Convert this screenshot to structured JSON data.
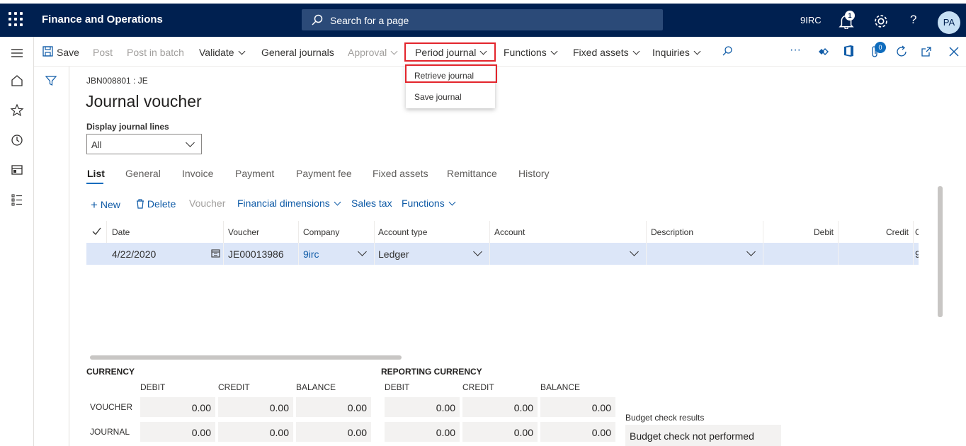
{
  "app": {
    "title": "Finance and Operations",
    "search_placeholder": "Search for a page",
    "company": "9IRC",
    "notification_count": "1",
    "user_initials": "PA",
    "help_glyph": "?"
  },
  "action_pane": {
    "save": "Save",
    "post": "Post",
    "post_in_batch": "Post in batch",
    "validate": "Validate",
    "general_journals": "General journals",
    "approval": "Approval",
    "period_journal": "Period journal",
    "functions": "Functions",
    "fixed_assets": "Fixed assets",
    "inquiries": "Inquiries",
    "more": "···",
    "attachments_count": "0"
  },
  "period_menu": {
    "items": [
      "Retrieve journal",
      "Save journal"
    ]
  },
  "header": {
    "caption": "JBN008801 : JE",
    "title": "Journal voucher",
    "display_lines_label": "Display journal lines",
    "display_lines_value": "All"
  },
  "tabs": [
    "List",
    "General",
    "Invoice",
    "Payment",
    "Payment fee",
    "Fixed assets",
    "Remittance",
    "History"
  ],
  "grid_toolbar": {
    "new": "New",
    "delete": "Delete",
    "voucher": "Voucher",
    "financial_dimensions": "Financial dimensions",
    "sales_tax": "Sales tax",
    "functions": "Functions"
  },
  "grid": {
    "columns": [
      "Date",
      "Voucher",
      "Company",
      "Account type",
      "Account",
      "Description",
      "Debit",
      "Credit",
      "C"
    ],
    "rows": [
      {
        "date": "4/22/2020",
        "voucher": "JE00013986",
        "company": "9irc",
        "account_type": "Ledger",
        "account": "",
        "description": "",
        "debit": "",
        "credit": "",
        "extra": "9"
      }
    ]
  },
  "totals": {
    "currency_title": "CURRENCY",
    "reporting_title": "REPORTING CURRENCY",
    "col_debit": "DEBIT",
    "col_credit": "CREDIT",
    "col_balance": "BALANCE",
    "row_voucher": "VOUCHER",
    "row_journal": "JOURNAL",
    "currency": {
      "voucher": {
        "debit": "0.00",
        "credit": "0.00",
        "balance": "0.00"
      },
      "journal": {
        "debit": "0.00",
        "credit": "0.00",
        "balance": "0.00"
      }
    },
    "reporting": {
      "voucher": {
        "debit": "0.00",
        "credit": "0.00",
        "balance": "0.00"
      },
      "journal": {
        "debit": "0.00",
        "credit": "0.00",
        "balance": "0.00"
      }
    },
    "budget_label": "Budget check results",
    "budget_value": "Budget check not performed"
  },
  "colors": {
    "topbar": "#002050",
    "accent": "#0f6cbd",
    "highlight_box": "#e3252c",
    "selected_row": "#dce6f8"
  }
}
